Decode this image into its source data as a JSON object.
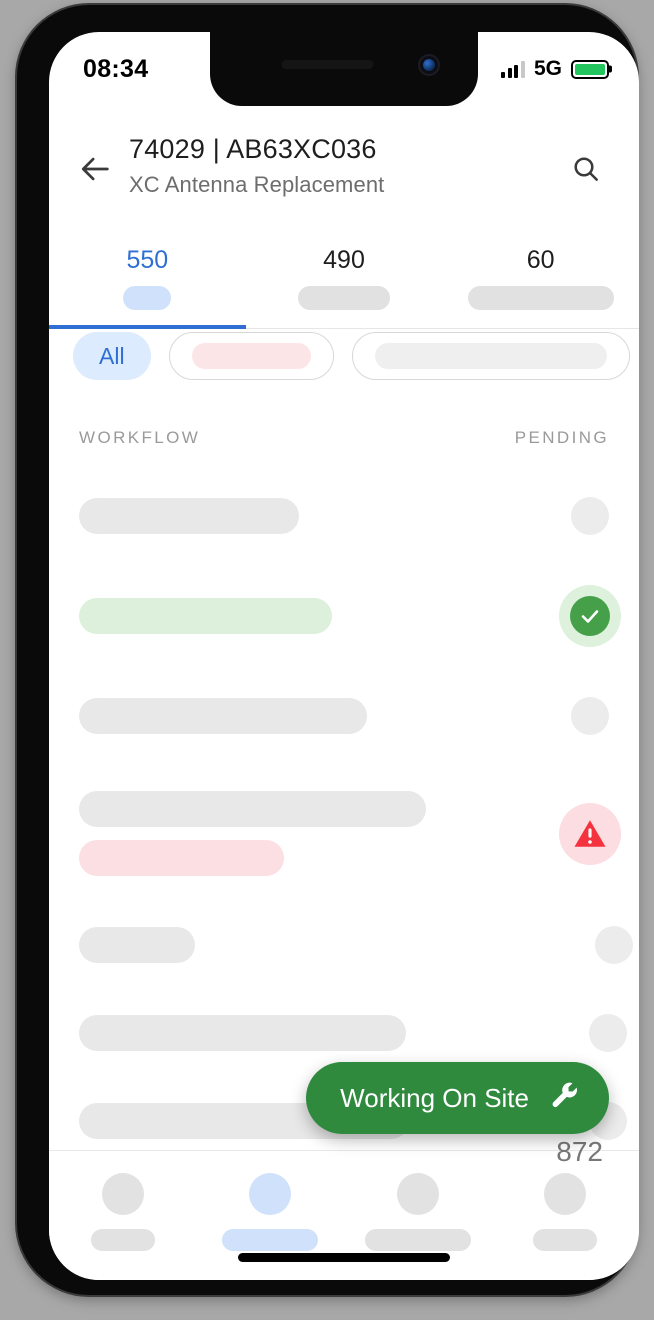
{
  "status_bar": {
    "time": "08:34",
    "network": "5G",
    "signal_icon": "signal-bars-icon",
    "battery_icon": "battery-full-icon",
    "battery_color": "#22c55e"
  },
  "header": {
    "back_icon": "back-arrow-icon",
    "title": "74029  |  AB63XC036",
    "subtitle": "XC Antenna Replacement",
    "search_icon": "search-icon"
  },
  "tabs": {
    "active_index": 0,
    "accent_color": "#2f6fd4",
    "items": [
      {
        "count": "550"
      },
      {
        "count": "490"
      },
      {
        "count": "60"
      }
    ]
  },
  "filters": {
    "chips": [
      {
        "label": "All",
        "selected": true
      },
      {
        "label": "",
        "selected": false,
        "tint": "#fbe5e7"
      },
      {
        "label": "",
        "selected": false,
        "tint": "#efefef"
      }
    ]
  },
  "list": {
    "columns": {
      "left": "WORKFLOW",
      "right": "PENDING"
    },
    "rows": [
      {
        "status": "pending",
        "bar_color": "#e8e8e8"
      },
      {
        "status": "complete",
        "bar_color": "#dcf0dc",
        "badge_icon": "check-circle-icon"
      },
      {
        "status": "pending",
        "bar_color": "#e8e8e8"
      },
      {
        "status": "warning",
        "bar_color": "#e8e8e8",
        "sub_bar_color": "#fcdfe3",
        "badge_icon": "warning-triangle-icon"
      },
      {
        "status": "pending",
        "bar_color": "#e8e8e8"
      },
      {
        "status": "pending",
        "bar_color": "#e8e8e8"
      },
      {
        "status": "pending",
        "bar_color": "#e8e8e8"
      },
      {
        "status": "pending",
        "bar_color": "#e8e8e8"
      }
    ],
    "overlay_number": "872"
  },
  "fab": {
    "label": "Working On Site",
    "icon": "wrench-icon",
    "color": "#2f8a3e"
  },
  "bottom_nav": {
    "active_index": 1,
    "items": [
      {
        "name": "nav-item-1"
      },
      {
        "name": "nav-item-2"
      },
      {
        "name": "nav-item-3"
      },
      {
        "name": "nav-item-4"
      }
    ]
  }
}
